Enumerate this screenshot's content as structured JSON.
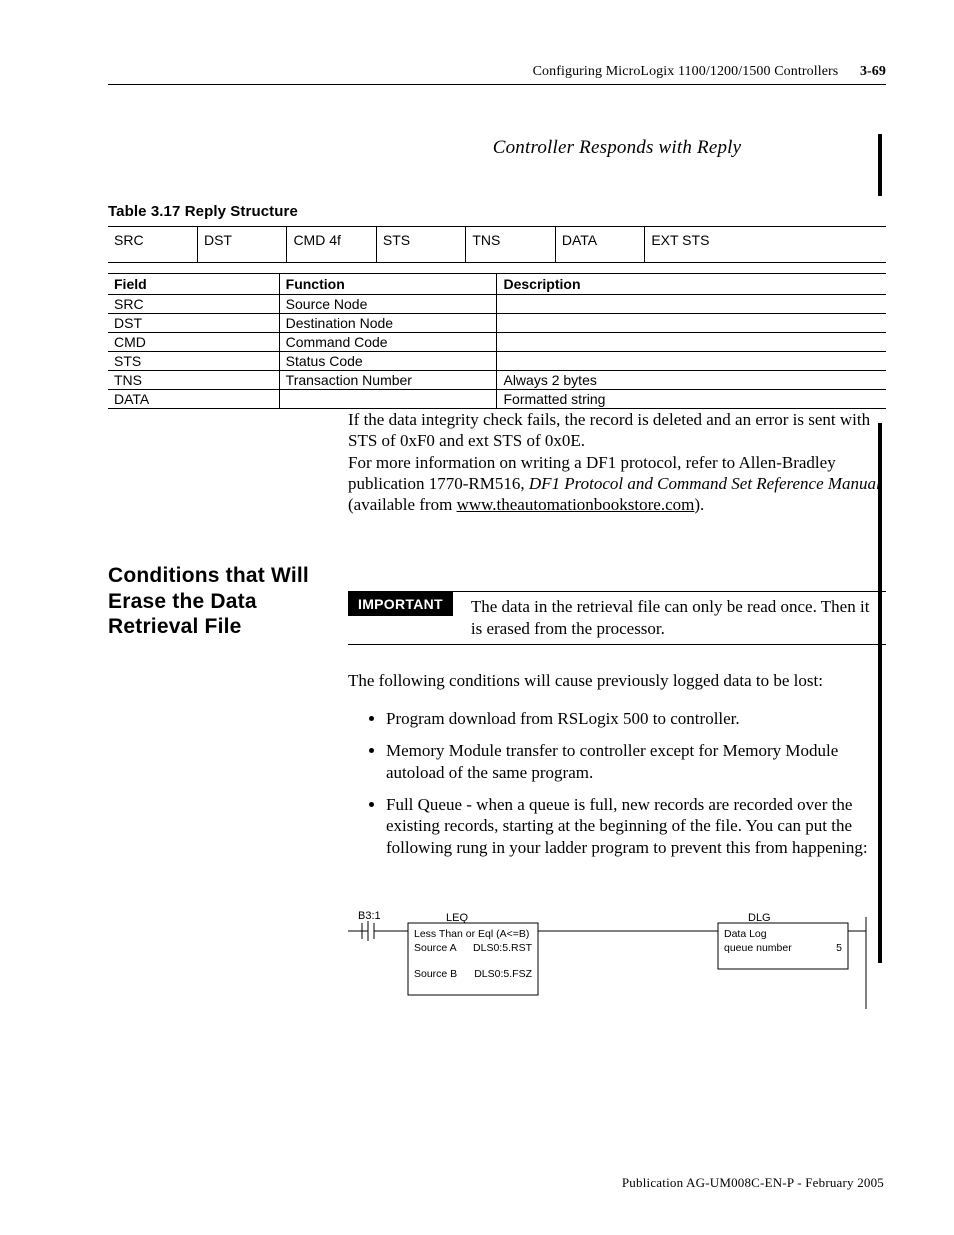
{
  "header": {
    "title": "Configuring MicroLogix 1100/1200/1500 Controllers",
    "page": "3-69"
  },
  "subtitle": "Controller Responds with Reply",
  "table1": {
    "caption": "Table 3.17 Reply Structure",
    "cells": [
      "SRC",
      "DST",
      "CMD 4f",
      "STS",
      "TNS",
      "DATA",
      "EXT STS"
    ]
  },
  "table2": {
    "head": [
      "Field",
      "Function",
      "Description"
    ],
    "rows": [
      [
        "SRC",
        "Source Node",
        ""
      ],
      [
        "DST",
        "Destination Node",
        ""
      ],
      [
        "CMD",
        "Command Code",
        ""
      ],
      [
        "STS",
        "Status Code",
        ""
      ],
      [
        "TNS",
        "Transaction Number",
        "Always 2 bytes"
      ],
      [
        "DATA",
        "",
        "Formatted string"
      ]
    ]
  },
  "para1": "If the data integrity check fails, the record is deleted and an error is sent with STS of 0xF0 and ext STS of 0x0E.",
  "para2a": "For more information on writing a DF1 protocol, refer to Allen-Bradley publication 1770-RM516, ",
  "para2i": "DF1 Protocol and Command Set Reference Manual",
  "para2b": " (available from ",
  "para2link": "www.theautomationbookstore.com",
  "para2c": ").",
  "section_head": "Conditions that Will Erase the Data Retrieval File",
  "important": {
    "tag": "IMPORTANT",
    "text": "The data in the retrieval file can only be read once. Then it is erased from the processor."
  },
  "para3": "The following conditions will cause previously logged data to be lost:",
  "bullets": [
    "Program download from RSLogix 500 to controller.",
    "Memory Module transfer to controller except for Memory Module autoload of the same program.",
    "Full Queue - when a queue is full, new records are recorded over the existing records, starting at the beginning of the file. You can put the following rung in your ladder program to prevent this from happening:"
  ],
  "ladder": {
    "contact": "B3:1",
    "leq": {
      "title": "LEQ",
      "desc": "Less Than or Eql (A<=B)",
      "a_label": "Source A",
      "a_val": "DLS0:5.RST",
      "b_label": "Source B",
      "b_val": "DLS0:5.FSZ"
    },
    "dlg": {
      "title": "DLG",
      "desc": "Data Log",
      "q_label": "queue number",
      "q_val": "5"
    }
  },
  "footer": "Publication AG-UM008C-EN-P - February 2005"
}
